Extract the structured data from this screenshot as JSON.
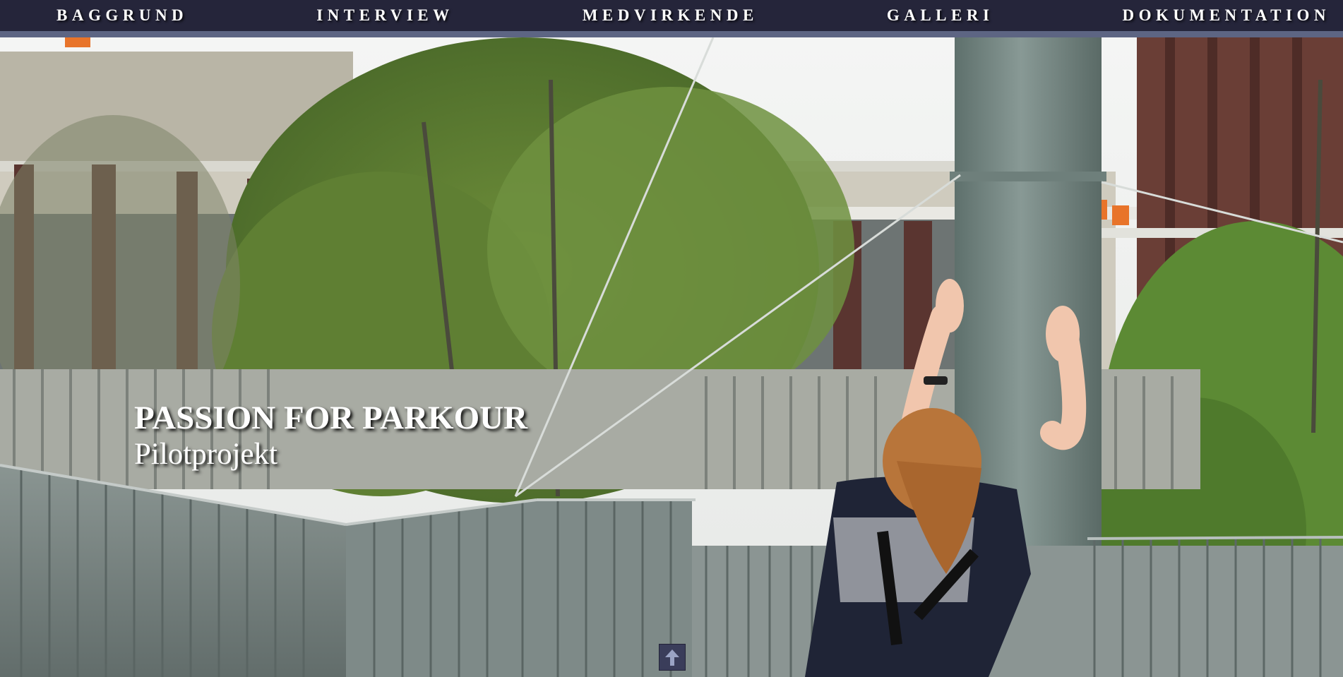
{
  "nav": {
    "items": [
      {
        "label": "BAGGRUND"
      },
      {
        "label": "INTERVIEW"
      },
      {
        "label": "MEDVIRKENDE"
      },
      {
        "label": "GALLERI"
      },
      {
        "label": "DOKUMENTATION"
      }
    ]
  },
  "hero": {
    "title": "PASSION FOR PARKOUR",
    "subtitle": "Pilotprojekt"
  },
  "scroll_top": {
    "icon": "arrow-up-icon"
  },
  "colors": {
    "nav_background": "#25253a",
    "nav_border": "#5d6583",
    "text": "#ffffff",
    "scroll_button": "#3a3d5a"
  }
}
